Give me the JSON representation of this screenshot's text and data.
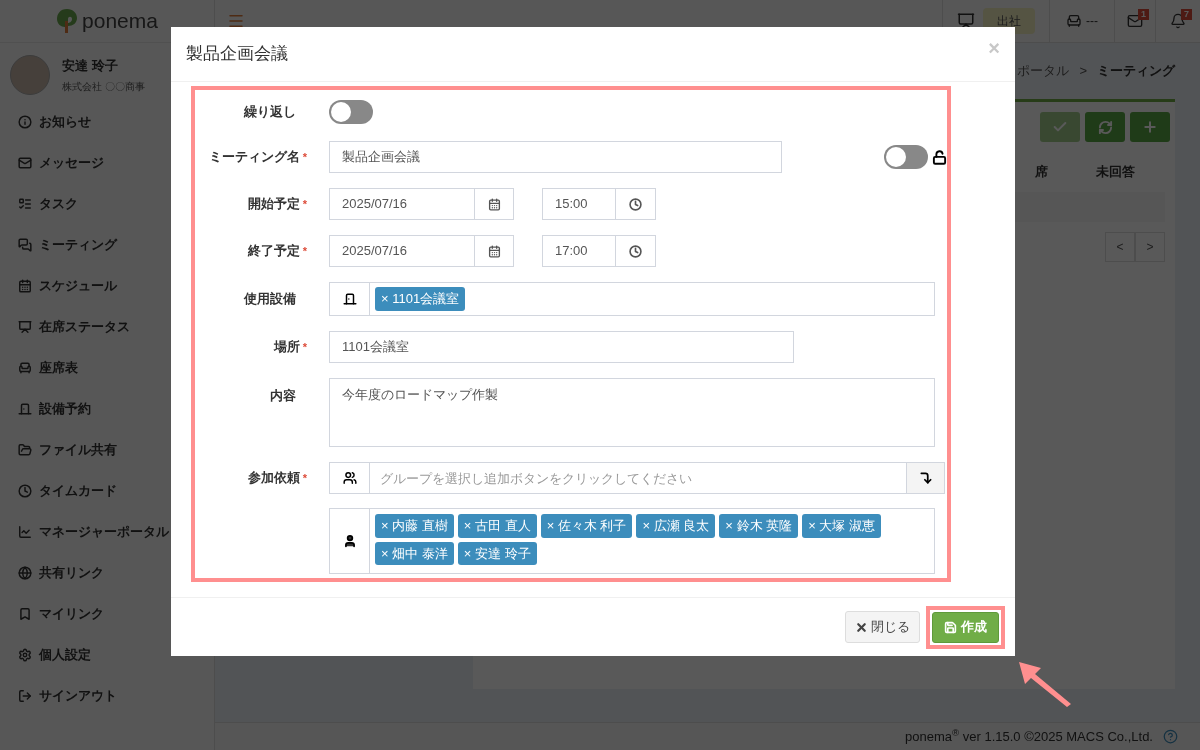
{
  "sidebar": {
    "logo": "ponema",
    "user": {
      "name": "安達 玲子",
      "company": "株式会社 〇〇商事"
    },
    "items": [
      {
        "label": "お知らせ"
      },
      {
        "label": "メッセージ"
      },
      {
        "label": "タスク"
      },
      {
        "label": "ミーティング"
      },
      {
        "label": "スケジュール"
      },
      {
        "label": "在席ステータス"
      },
      {
        "label": "座席表"
      },
      {
        "label": "設備予約"
      },
      {
        "label": "ファイル共有"
      },
      {
        "label": "タイムカード"
      },
      {
        "label": "マネージャーポータル"
      },
      {
        "label": "共有リンク"
      },
      {
        "label": "マイリンク"
      },
      {
        "label": "個人設定"
      },
      {
        "label": "サインアウト"
      }
    ]
  },
  "topbar": {
    "status": "出社",
    "seat": "---",
    "mail_count": "1",
    "bell_count": "7"
  },
  "breadcrumb": [
    "ポータル",
    ">",
    "ミーティング"
  ],
  "toolbar": [
    {
      "kind": "check",
      "disabled": true
    },
    {
      "kind": "refresh",
      "disabled": false
    },
    {
      "kind": "add",
      "disabled": false
    }
  ],
  "table": {
    "columns": [
      "席",
      "未回答"
    ]
  },
  "pager": [
    "<",
    ">"
  ],
  "footer": "ponema$^{®}$ ver 1.15.0 ©2025 MACS Co.,Ltd.",
  "modal": {
    "title": "製品企画会議",
    "close": "×",
    "repeat": {
      "label": "繰り返し",
      "on": false
    },
    "name": {
      "label": "ミーティング名",
      "required_mark": "*",
      "value": "製品企画会議",
      "lock_on": false
    },
    "start": {
      "label": "開始予定",
      "required_mark": "*",
      "date": "2025/07/16",
      "time": "15:00"
    },
    "end": {
      "label": "終了予定",
      "required_mark": "*",
      "date": "2025/07/16",
      "time": "17:00"
    },
    "equipment": {
      "label": "使用設備",
      "tags": [
        "× 1101会議室"
      ]
    },
    "place": {
      "label": "場所",
      "required_mark": "*",
      "value": "1101会議室"
    },
    "content": {
      "label": "内容",
      "value": "今年度のロードマップ作製"
    },
    "participants": {
      "label": "参加依頼",
      "required_mark": "*",
      "placeholder": "グループを選択し追加ボタンをクリックしてください",
      "tags": [
        "× 内藤 直樹",
        "× 古田 直人",
        "× 佐々木 利子",
        "× 広瀬 良太",
        "× 鈴木 英隆",
        "× 大塚 淑恵",
        "× 畑中 泰洋",
        "× 安達 玲子"
      ]
    },
    "buttons": {
      "close": "閉じる",
      "create": "作成"
    }
  }
}
